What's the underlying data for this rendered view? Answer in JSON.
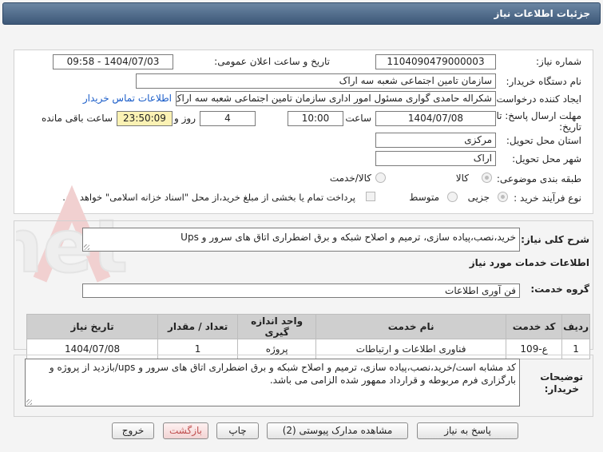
{
  "page": {
    "title": "جزئیات اطلاعات نیاز"
  },
  "form": {
    "need_number_label": "شماره نیاز:",
    "need_number": "1104090479000003",
    "announce_datetime_label": "تاریخ و ساعت اعلان عمومی:",
    "announce_datetime": "1404/07/03 - 09:58",
    "buyer_org_label": "نام دستگاه خریدار:",
    "buyer_org": "سازمان تامین اجتماعی شعبه سه اراک",
    "requester_label": "ایجاد کننده درخواست:",
    "requester": "شکراله حامدی گواری مسئول امور اداری سازمان تامین اجتماعی شعبه سه اراک",
    "contact_link": "اطلاعات تماس خریدار",
    "deadline_label_1": "مهلت ارسال پاسخ: تا",
    "deadline_label_2": "تاریخ:",
    "deadline_date": "1404/07/08",
    "time_label": "ساعت",
    "deadline_time": "10:00",
    "days_value": "4",
    "days_label": "روز و",
    "remaining_time": "23:50:09",
    "remaining_label": "ساعت باقی مانده",
    "province_label": "استان محل تحویل:",
    "province": "مرکزی",
    "city_label": "شهر محل تحویل:",
    "city": "اراک",
    "category_label": "طبقه بندی موضوعی:",
    "category_options": [
      "کالا",
      "کالا/خدمت"
    ],
    "process_label": "نوع فرآیند خرید :",
    "process_options": [
      "جزیی",
      "متوسط"
    ],
    "payment_note": "پرداخت تمام یا بخشی از مبلغ خرید،از محل \"اسناد خزانه اسلامی\" خواهد بود."
  },
  "summary": {
    "label": "شرح کلی نیاز:",
    "text": "خرید،نصب،پیاده سازی، ترمیم و اصلاح شبکه و برق اضطراری اتاق های سرور و Ups"
  },
  "services": {
    "section_title": "اطلاعات خدمات مورد نیاز",
    "group_label": "گروه خدمت:",
    "group_value": "فن آوری اطلاعات",
    "columns": [
      "ردیف",
      "کد خدمت",
      "نام خدمت",
      "واحد اندازه گیری",
      "تعداد / مقدار",
      "تاریخ نیاز"
    ],
    "rows": [
      [
        "1",
        "ع-109",
        "فناوری اطلاعات و ارتباطات",
        "پروژه",
        "1",
        "1404/07/08"
      ]
    ]
  },
  "buyer_notes": {
    "label_1": "توضیحات",
    "label_2": "خریدار:",
    "text": "کد مشابه است/خرید،نصب،پیاده سازی، ترمیم و اصلاح شبکه و برق اضطراری اتاق های سرور و ups/بازدید از پروژه و بارگزاری فرم مربوطه و قرارداد ممهور شده الزامی می باشد."
  },
  "buttons": {
    "reply": "پاسخ به نیاز",
    "attachments": "مشاهده مدارک پیوستی (2)",
    "print": "چاپ",
    "back": "بازگشت",
    "exit": "خروج"
  },
  "watermark": "AriaTender.net",
  "colors": {
    "header": "#4b6788",
    "link": "#1a5dc9",
    "remaining_bg": "#fbf2b4"
  }
}
